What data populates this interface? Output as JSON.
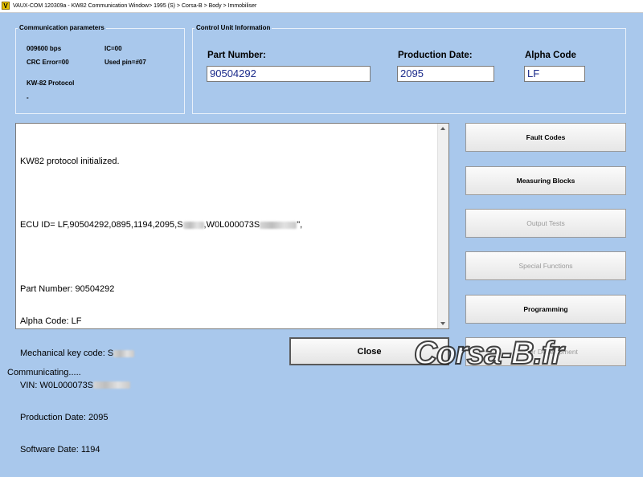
{
  "window": {
    "title": "VAUX-COM 120309a - KW82 Communication Window> 1995 (S) > Corsa-B > Body > Immobiliser",
    "icon_letter": "V"
  },
  "comm_params": {
    "legend": "Communication parameters",
    "baud": "009600 bps",
    "ic": "IC=00",
    "crc": "CRC Error=00",
    "used_pin": "Used pin=#07",
    "protocol": "KW-82 Protocol",
    "dash": "-"
  },
  "control_unit": {
    "legend": "Control Unit Information",
    "part_number_label": "Part Number:",
    "part_number_value": "90504292",
    "production_date_label": "Production Date:",
    "production_date_value": "2095",
    "alpha_code_label": "Alpha Code",
    "alpha_code_value": "LF"
  },
  "log": {
    "lines": {
      "l1": "KW82 protocol initialized.",
      "l2a": "ECU ID= LF,90504292,0895,1194,2095,S",
      "l2b": ",W0L000073S",
      "l2c": "\",",
      "l3": "Part Number: 90504292",
      "l4": "Alpha Code: LF",
      "l5": "Mechanical key code: S",
      "l6": "VIN: W0L000073S",
      "l7": "Production Date: 2095",
      "l8": "Software Date: 1194"
    }
  },
  "buttons": {
    "fault_codes": "Fault Codes",
    "measuring_blocks": "Measuring Blocks",
    "output_tests": "Output Tests",
    "special_functions": "Special Functions",
    "programming": "Programming",
    "further_development": "Further Development",
    "close": "Close"
  },
  "status": "Communicating.....",
  "watermark": "Corsa-B.fr"
}
